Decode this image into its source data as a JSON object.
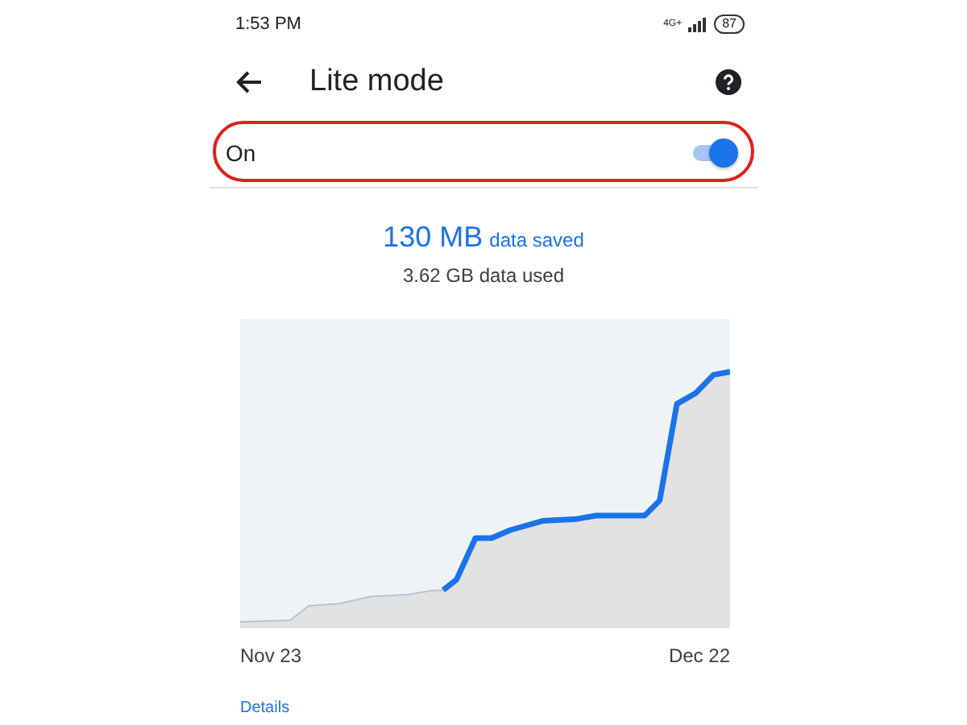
{
  "status_bar": {
    "time": "1:53 PM",
    "network": "4G+",
    "battery": "87"
  },
  "app_bar": {
    "title": "Lite mode"
  },
  "toggle": {
    "label": "On",
    "on": true,
    "highlighted": true
  },
  "summary": {
    "saved_amount": "130 MB",
    "saved_label": "data saved",
    "used": "3.62 GB data used"
  },
  "chart": {
    "start_label": "Nov 23",
    "end_label": "Dec 22"
  },
  "details_link": "Details"
}
